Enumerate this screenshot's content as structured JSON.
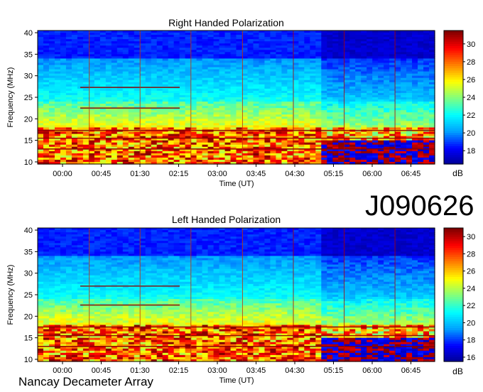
{
  "observation_id": "J090626",
  "footer_label": "Nancay Decameter Array",
  "chart_data": [
    {
      "type": "heatmap",
      "title": "Right Handed Polarization",
      "xlabel": "Time (UT)",
      "ylabel": "Frequency (MHz)",
      "x_tick_labels": [
        "00:00",
        "00:45",
        "01:30",
        "02:15",
        "03:00",
        "03:45",
        "04:30",
        "05:15",
        "06:00",
        "06:45"
      ],
      "y_ticks": [
        10,
        15,
        20,
        25,
        30,
        35,
        40
      ],
      "ylim": [
        9.5,
        40.5
      ],
      "colorbar": {
        "label": "dB",
        "ticks": [
          18,
          20,
          22,
          24,
          26,
          28,
          30
        ],
        "range": [
          16.5,
          31.5
        ]
      },
      "colormap": [
        "#00008f",
        "#0000ff",
        "#00a0ff",
        "#00ffff",
        "#7fff7f",
        "#ffff00",
        "#ff8000",
        "#ff0000",
        "#800000"
      ]
    },
    {
      "type": "heatmap",
      "title": "Left Handed Polarization",
      "xlabel": "Time (UT)",
      "ylabel": "Frequency (MHz)",
      "x_tick_labels": [
        "00:00",
        "00:45",
        "01:30",
        "02:15",
        "03:00",
        "03:45",
        "04:30",
        "05:15",
        "06:00",
        "06:45"
      ],
      "y_ticks": [
        10,
        15,
        20,
        25,
        30,
        35,
        40
      ],
      "ylim": [
        9.5,
        40.5
      ],
      "colorbar": {
        "label": "dB",
        "ticks": [
          16,
          18,
          20,
          22,
          24,
          26,
          28,
          30
        ],
        "range": [
          15.5,
          31
        ]
      },
      "colormap": [
        "#00008f",
        "#0000ff",
        "#00a0ff",
        "#00ffff",
        "#7fff7f",
        "#ffff00",
        "#ff8000",
        "#ff0000",
        "#800000"
      ]
    }
  ]
}
